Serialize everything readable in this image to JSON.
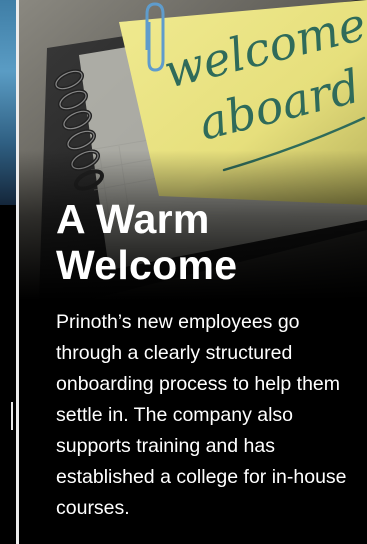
{
  "card": {
    "title": "A Warm Welcome",
    "body": "Prinoth’s new employees go through a clearly structured onboarding process to help them settle in. The company also supports training and has established a college for in-house courses.",
    "image": {
      "handwriting_line1": "welcome",
      "handwriting_line2": "aboard"
    }
  },
  "colors": {
    "background": "#000000",
    "text": "#ffffff",
    "sticky_note": "#e8e07a",
    "handwriting": "#2f6b5a",
    "divider": "#ececec"
  }
}
